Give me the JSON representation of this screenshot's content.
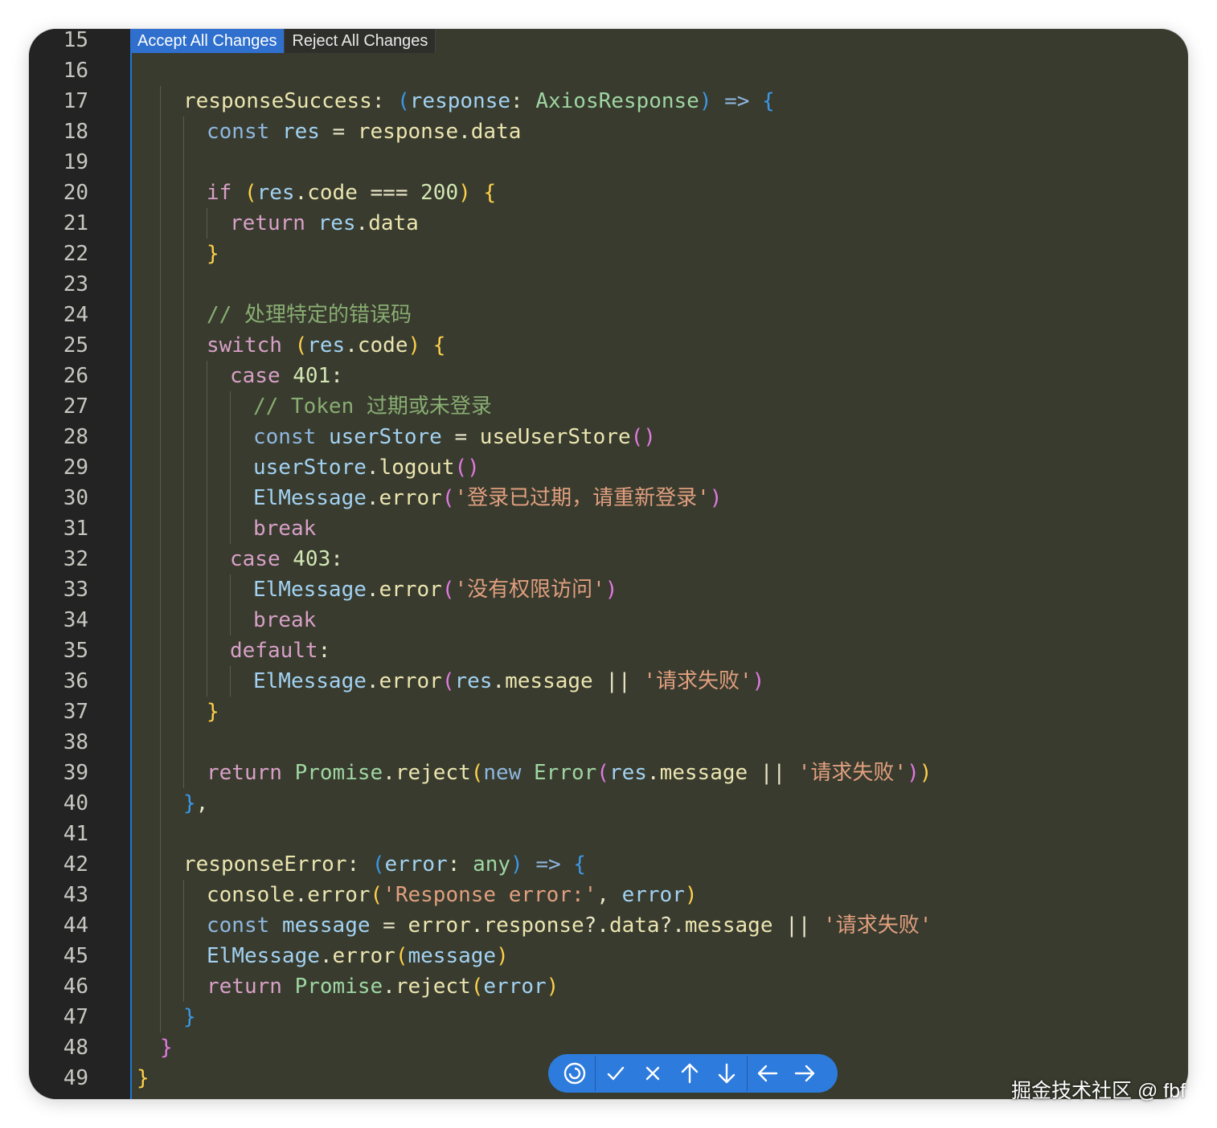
{
  "diff_actions": {
    "accept_all": "Accept All Changes",
    "reject_all": "Reject All Changes"
  },
  "lines": [
    {
      "n": "15",
      "indent": 0,
      "tokens": []
    },
    {
      "n": "16",
      "indent": 0,
      "tokens": []
    },
    {
      "n": "17",
      "indent": 2,
      "tokens": [
        [
          "fn",
          "responseSuccess"
        ],
        [
          "op",
          ": "
        ],
        [
          "p3",
          "("
        ],
        [
          "var",
          "response"
        ],
        [
          "op",
          ": "
        ],
        [
          "type",
          "AxiosResponse"
        ],
        [
          "p3",
          ")"
        ],
        [
          "op",
          " "
        ],
        [
          "kw",
          "=>"
        ],
        [
          "op",
          " "
        ],
        [
          "p3",
          "{"
        ]
      ]
    },
    {
      "n": "18",
      "indent": 3,
      "tokens": [
        [
          "kw",
          "const"
        ],
        [
          "op",
          " "
        ],
        [
          "var",
          "res"
        ],
        [
          "op",
          " = "
        ],
        [
          "fn",
          "response"
        ],
        [
          "op",
          "."
        ],
        [
          "fn",
          "data"
        ]
      ]
    },
    {
      "n": "19",
      "indent": 0,
      "tokens": []
    },
    {
      "n": "20",
      "indent": 3,
      "tokens": [
        [
          "ctl",
          "if"
        ],
        [
          "op",
          " "
        ],
        [
          "p1",
          "("
        ],
        [
          "var",
          "res"
        ],
        [
          "op",
          "."
        ],
        [
          "fn",
          "code"
        ],
        [
          "op",
          " === "
        ],
        [
          "num",
          "200"
        ],
        [
          "p1",
          ")"
        ],
        [
          "op",
          " "
        ],
        [
          "p1",
          "{"
        ]
      ]
    },
    {
      "n": "21",
      "indent": 4,
      "tokens": [
        [
          "ctl",
          "return"
        ],
        [
          "op",
          " "
        ],
        [
          "var",
          "res"
        ],
        [
          "op",
          "."
        ],
        [
          "fn",
          "data"
        ]
      ]
    },
    {
      "n": "22",
      "indent": 3,
      "tokens": [
        [
          "p1",
          "}"
        ]
      ]
    },
    {
      "n": "23",
      "indent": 0,
      "tokens": []
    },
    {
      "n": "24",
      "indent": 3,
      "tokens": [
        [
          "com",
          "// 处理特定的错误码"
        ]
      ]
    },
    {
      "n": "25",
      "indent": 3,
      "tokens": [
        [
          "ctl",
          "switch"
        ],
        [
          "op",
          " "
        ],
        [
          "p1",
          "("
        ],
        [
          "var",
          "res"
        ],
        [
          "op",
          "."
        ],
        [
          "fn",
          "code"
        ],
        [
          "p1",
          ")"
        ],
        [
          "op",
          " "
        ],
        [
          "p1",
          "{"
        ]
      ]
    },
    {
      "n": "26",
      "indent": 4,
      "tokens": [
        [
          "ctl",
          "case"
        ],
        [
          "op",
          " "
        ],
        [
          "num",
          "401"
        ],
        [
          "op",
          ":"
        ]
      ]
    },
    {
      "n": "27",
      "indent": 5,
      "tokens": [
        [
          "com",
          "// Token 过期或未登录"
        ]
      ]
    },
    {
      "n": "28",
      "indent": 5,
      "tokens": [
        [
          "kw",
          "const"
        ],
        [
          "op",
          " "
        ],
        [
          "var",
          "userStore"
        ],
        [
          "op",
          " = "
        ],
        [
          "fn",
          "useUserStore"
        ],
        [
          "p2",
          "()"
        ]
      ]
    },
    {
      "n": "29",
      "indent": 5,
      "tokens": [
        [
          "var",
          "userStore"
        ],
        [
          "op",
          "."
        ],
        [
          "fn",
          "logout"
        ],
        [
          "p2",
          "()"
        ]
      ]
    },
    {
      "n": "30",
      "indent": 5,
      "tokens": [
        [
          "var",
          "ElMessage"
        ],
        [
          "op",
          "."
        ],
        [
          "fn",
          "error"
        ],
        [
          "p2",
          "("
        ],
        [
          "str",
          "'登录已过期，请重新登录'"
        ],
        [
          "p2",
          ")"
        ]
      ]
    },
    {
      "n": "31",
      "indent": 5,
      "tokens": [
        [
          "ctl",
          "break"
        ]
      ]
    },
    {
      "n": "32",
      "indent": 4,
      "tokens": [
        [
          "ctl",
          "case"
        ],
        [
          "op",
          " "
        ],
        [
          "num",
          "403"
        ],
        [
          "op",
          ":"
        ]
      ]
    },
    {
      "n": "33",
      "indent": 5,
      "tokens": [
        [
          "var",
          "ElMessage"
        ],
        [
          "op",
          "."
        ],
        [
          "fn",
          "error"
        ],
        [
          "p2",
          "("
        ],
        [
          "str",
          "'没有权限访问'"
        ],
        [
          "p2",
          ")"
        ]
      ]
    },
    {
      "n": "34",
      "indent": 5,
      "tokens": [
        [
          "ctl",
          "break"
        ]
      ]
    },
    {
      "n": "35",
      "indent": 4,
      "tokens": [
        [
          "ctl",
          "default"
        ],
        [
          "op",
          ":"
        ]
      ]
    },
    {
      "n": "36",
      "indent": 5,
      "tokens": [
        [
          "var",
          "ElMessage"
        ],
        [
          "op",
          "."
        ],
        [
          "fn",
          "error"
        ],
        [
          "p2",
          "("
        ],
        [
          "var",
          "res"
        ],
        [
          "op",
          "."
        ],
        [
          "fn",
          "message"
        ],
        [
          "op",
          " || "
        ],
        [
          "str",
          "'请求失败'"
        ],
        [
          "p2",
          ")"
        ]
      ]
    },
    {
      "n": "37",
      "indent": 3,
      "tokens": [
        [
          "p1",
          "}"
        ]
      ]
    },
    {
      "n": "38",
      "indent": 0,
      "tokens": []
    },
    {
      "n": "39",
      "indent": 3,
      "tokens": [
        [
          "ctl",
          "return"
        ],
        [
          "op",
          " "
        ],
        [
          "type",
          "Promise"
        ],
        [
          "op",
          "."
        ],
        [
          "fn",
          "reject"
        ],
        [
          "p1",
          "("
        ],
        [
          "kw",
          "new"
        ],
        [
          "op",
          " "
        ],
        [
          "type",
          "Error"
        ],
        [
          "p2",
          "("
        ],
        [
          "var",
          "res"
        ],
        [
          "op",
          "."
        ],
        [
          "fn",
          "message"
        ],
        [
          "op",
          " || "
        ],
        [
          "str",
          "'请求失败'"
        ],
        [
          "p2",
          ")"
        ],
        [
          "p1",
          ")"
        ]
      ]
    },
    {
      "n": "40",
      "indent": 2,
      "tokens": [
        [
          "p3",
          "}"
        ],
        [
          "op",
          ","
        ]
      ]
    },
    {
      "n": "41",
      "indent": 0,
      "tokens": []
    },
    {
      "n": "42",
      "indent": 2,
      "tokens": [
        [
          "fn",
          "responseError"
        ],
        [
          "op",
          ": "
        ],
        [
          "p3",
          "("
        ],
        [
          "var",
          "error"
        ],
        [
          "op",
          ": "
        ],
        [
          "type",
          "any"
        ],
        [
          "p3",
          ")"
        ],
        [
          "op",
          " "
        ],
        [
          "kw",
          "=>"
        ],
        [
          "op",
          " "
        ],
        [
          "p3",
          "{"
        ]
      ]
    },
    {
      "n": "43",
      "indent": 3,
      "tokens": [
        [
          "fn",
          "console"
        ],
        [
          "op",
          "."
        ],
        [
          "fn",
          "error"
        ],
        [
          "p1",
          "("
        ],
        [
          "str",
          "'Response error:'"
        ],
        [
          "op",
          ", "
        ],
        [
          "var",
          "error"
        ],
        [
          "p1",
          ")"
        ]
      ]
    },
    {
      "n": "44",
      "indent": 3,
      "tokens": [
        [
          "kw",
          "const"
        ],
        [
          "op",
          " "
        ],
        [
          "var",
          "message"
        ],
        [
          "op",
          " = "
        ],
        [
          "fn",
          "error"
        ],
        [
          "op",
          "."
        ],
        [
          "fn",
          "response"
        ],
        [
          "op",
          "?."
        ],
        [
          "fn",
          "data"
        ],
        [
          "op",
          "?."
        ],
        [
          "fn",
          "message"
        ],
        [
          "op",
          " || "
        ],
        [
          "str",
          "'请求失败'"
        ]
      ]
    },
    {
      "n": "45",
      "indent": 3,
      "tokens": [
        [
          "var",
          "ElMessage"
        ],
        [
          "op",
          "."
        ],
        [
          "fn",
          "error"
        ],
        [
          "p1",
          "("
        ],
        [
          "var",
          "message"
        ],
        [
          "p1",
          ")"
        ]
      ]
    },
    {
      "n": "46",
      "indent": 3,
      "tokens": [
        [
          "ctl",
          "return"
        ],
        [
          "op",
          " "
        ],
        [
          "type",
          "Promise"
        ],
        [
          "op",
          "."
        ],
        [
          "fn",
          "reject"
        ],
        [
          "p1",
          "("
        ],
        [
          "var",
          "error"
        ],
        [
          "p1",
          ")"
        ]
      ]
    },
    {
      "n": "47",
      "indent": 2,
      "tokens": [
        [
          "p3",
          "}"
        ]
      ]
    },
    {
      "n": "48",
      "indent": 1,
      "tokens": [
        [
          "p2",
          "}"
        ]
      ]
    },
    {
      "n": "49",
      "indent": 0,
      "tokens": [
        [
          "p1",
          "}"
        ]
      ]
    }
  ],
  "toolbar": {
    "buttons": [
      "review-icon",
      "check-icon",
      "close-icon",
      "arrow-up-icon",
      "arrow-down-icon",
      "arrow-left-icon",
      "arrow-right-icon"
    ]
  },
  "watermark": "掘金技术社区 @ fbf"
}
